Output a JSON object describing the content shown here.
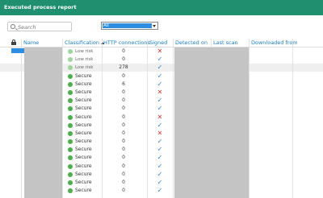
{
  "window": {
    "title": "Executed process report"
  },
  "toolbar": {
    "search_placeholder": "Search",
    "filter_value": "All"
  },
  "columns": {
    "name": "Name",
    "classification": "Classification",
    "http_connections": "HTTP connections",
    "signed": "Signed",
    "detected_on": "Detected on",
    "last_scan": "Last scan",
    "downloaded_from": "Downloaded from"
  },
  "rows": [
    {
      "classification": "Low risk",
      "connections": "0",
      "signed": false
    },
    {
      "classification": "Low risk",
      "connections": "0",
      "signed": true
    },
    {
      "classification": "Low risk",
      "connections": "278",
      "signed": true
    },
    {
      "classification": "Secure",
      "connections": "0",
      "signed": true
    },
    {
      "classification": "Secure",
      "connections": "6",
      "signed": true
    },
    {
      "classification": "Secure",
      "connections": "0",
      "signed": false
    },
    {
      "classification": "Secure",
      "connections": "0",
      "signed": true
    },
    {
      "classification": "Secure",
      "connections": "0",
      "signed": true
    },
    {
      "classification": "Secure",
      "connections": "0",
      "signed": false
    },
    {
      "classification": "Secure",
      "connections": "0",
      "signed": true
    },
    {
      "classification": "Secure",
      "connections": "0",
      "signed": false
    },
    {
      "classification": "Secure",
      "connections": "0",
      "signed": true
    },
    {
      "classification": "Secure",
      "connections": "0",
      "signed": true
    },
    {
      "classification": "Secure",
      "connections": "0",
      "signed": true
    },
    {
      "classification": "Secure",
      "connections": "0",
      "signed": true
    },
    {
      "classification": "Secure",
      "connections": "0",
      "signed": true
    },
    {
      "classification": "Secure",
      "connections": "0",
      "signed": true
    },
    {
      "classification": "Secure",
      "connections": "0",
      "signed": true
    }
  ],
  "icons": {
    "signed_yes": "checkmark-icon",
    "signed_no": "cross-icon",
    "classification_dot": "status-dot-icon",
    "lock": "lock-icon",
    "search": "search-icon"
  },
  "colors": {
    "titlebar": "#1f8f6f",
    "header_text": "#1a7cc0",
    "secure": "#4cae4c",
    "low_risk": "#9fd59f",
    "check": "#2d7cc6",
    "cross": "#d43030",
    "selection": "#2d8de0"
  }
}
